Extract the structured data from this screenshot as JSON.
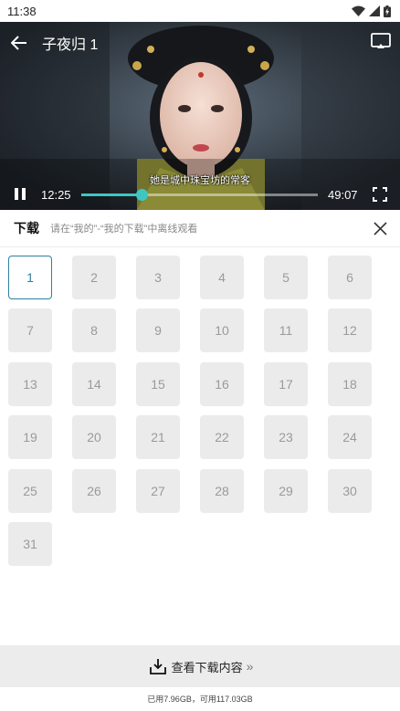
{
  "status_bar": {
    "time": "11:38"
  },
  "player": {
    "title": "子夜归 1",
    "subtitle": "她是城中珠宝坊的常客",
    "current_time": "12:25",
    "total_time": "49:07",
    "progress": 0.253
  },
  "download": {
    "title": "下载",
    "hint": "请在“我的”-“我的下载”中离线观看"
  },
  "episodes": {
    "items": [
      "1",
      "2",
      "3",
      "4",
      "5",
      "6",
      "7",
      "8",
      "9",
      "10",
      "11",
      "12",
      "13",
      "14",
      "15",
      "16",
      "17",
      "18",
      "19",
      "20",
      "21",
      "22",
      "23",
      "24",
      "25",
      "26",
      "27",
      "28",
      "29",
      "30",
      "31"
    ],
    "selected": "1"
  },
  "footer": {
    "view_label": "查看下载内容",
    "chevron": "»",
    "storage": "已用7.96GB，可用117.03GB"
  },
  "colors": {
    "accent": "#3ec7c1",
    "selected_border": "#2f7f9f"
  }
}
